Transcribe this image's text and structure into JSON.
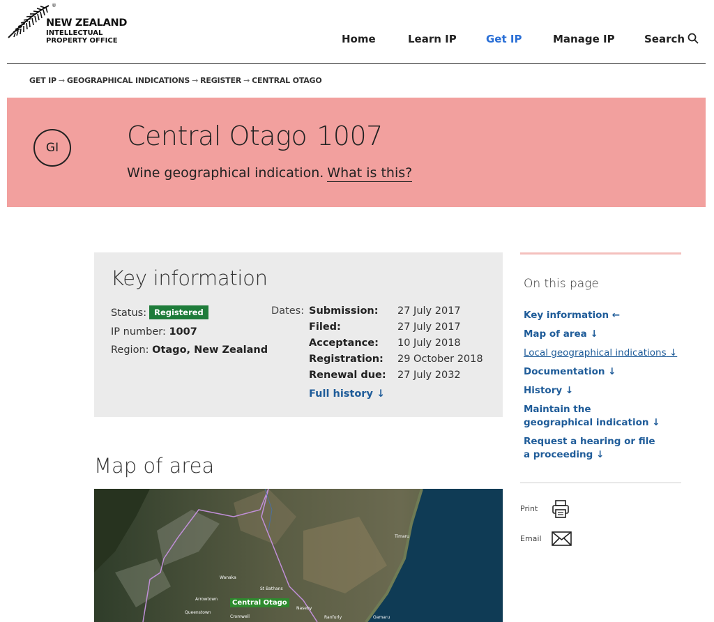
{
  "header": {
    "logo": {
      "line1": "NEW ZEALAND",
      "line2": "INTELLECTUAL",
      "line3": "PROPERTY OFFICE",
      "reg": "®"
    },
    "nav": [
      {
        "label": "Home"
      },
      {
        "label": "Learn IP"
      },
      {
        "label": "Get IP",
        "active": true
      },
      {
        "label": "Manage IP"
      },
      {
        "label": "Search"
      }
    ]
  },
  "breadcrumb": [
    "GET IP",
    "GEOGRAPHICAL INDICATIONS",
    "REGISTER",
    "CENTRAL OTAGO"
  ],
  "breadcrumb_sep": "→",
  "hero": {
    "badge": "GI",
    "title": "Central Otago",
    "number": "1007",
    "subtitle": "Wine geographical indication.",
    "link": "What is this?",
    "bg": "#f2a09e"
  },
  "key_info": {
    "title": "Key information",
    "status_label": "Status:",
    "status_value": "Registered",
    "ip_label": "IP number:",
    "ip_value": "1007",
    "region_label": "Region:",
    "region_value": "Otago, New Zealand",
    "dates_label": "Dates:",
    "dates": [
      {
        "label": "Submission:",
        "value": "27 July 2017"
      },
      {
        "label": "Filed:",
        "value": "27 July 2017"
      },
      {
        "label": "Acceptance:",
        "value": "10 July 2018"
      },
      {
        "label": "Registration:",
        "value": "29 October 2018"
      },
      {
        "label": "Renewal due:",
        "value": "27 July 2032"
      }
    ],
    "full_history": "Full history",
    "down_arrow": "↓"
  },
  "map": {
    "title": "Map of area",
    "labels": {
      "timaru": "Timaru",
      "wanaka": "Wanaka",
      "st_bathans": "St Bathans",
      "arrowtown": "Arrowtown",
      "queenstown": "Queenstown",
      "cromwell": "Cromwell",
      "naseby": "Naseby",
      "oamaru": "Oamaru",
      "ranfurly": "Ranfurly"
    },
    "region_badge": "Central Otago"
  },
  "sidebar": {
    "title": "On this page",
    "links": [
      {
        "label": "Key information",
        "arrow": "←"
      },
      {
        "label": "Map of area",
        "arrow": "↓"
      },
      {
        "label": "Local geographical indications",
        "arrow": "↓"
      },
      {
        "label": "Documentation",
        "arrow": "↓"
      },
      {
        "label": "History",
        "arrow": "↓"
      },
      {
        "label": "Maintain the geographical indication",
        "arrow": "↓"
      },
      {
        "label": "Request a hearing or file a proceeding",
        "arrow": "↓"
      }
    ],
    "print": "Print",
    "email": "Email"
  },
  "colors": {
    "accent": "#2a6fd6",
    "link": "#1f5c99",
    "status_green": "#1e7c3a",
    "hero_pink": "#f2a09e"
  }
}
